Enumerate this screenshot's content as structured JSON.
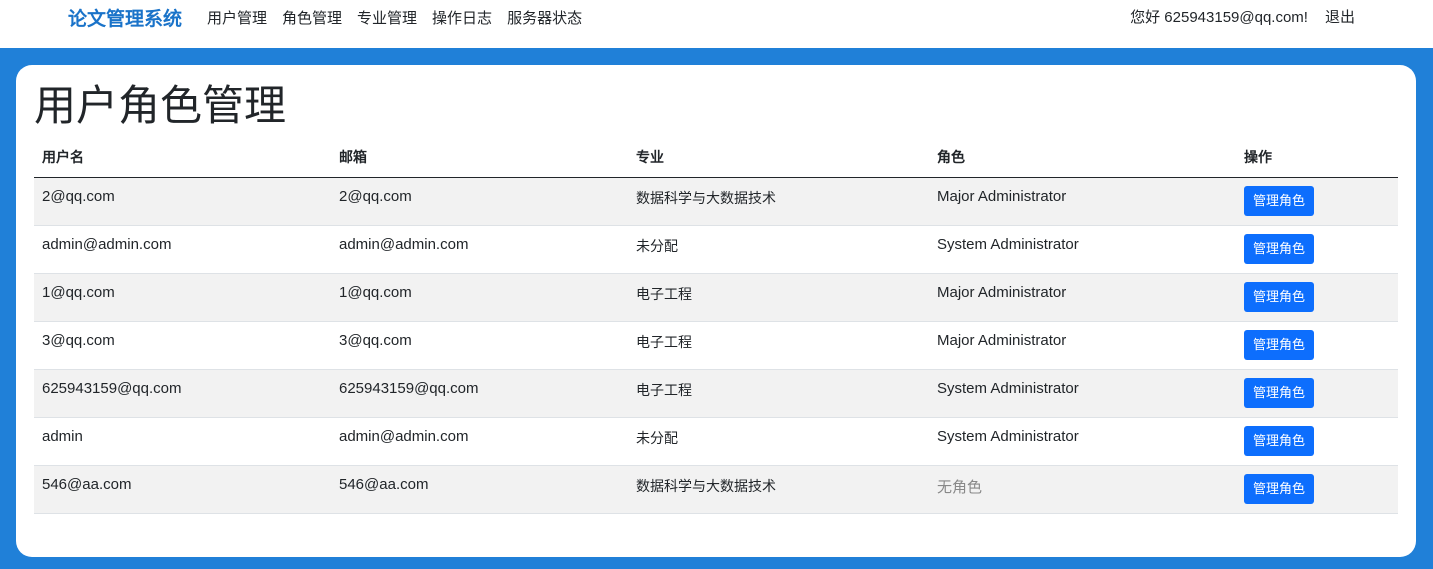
{
  "navbar": {
    "brand": "论文管理系统",
    "links": [
      "用户管理",
      "角色管理",
      "专业管理",
      "操作日志",
      "服务器状态"
    ],
    "greeting": "您好 625943159@qq.com!",
    "logout": "退出"
  },
  "page": {
    "title": "用户角色管理"
  },
  "table": {
    "headers": [
      "用户名",
      "邮箱",
      "专业",
      "角色",
      "操作"
    ],
    "rows": [
      {
        "username": "2@qq.com",
        "email": "2@qq.com",
        "major": "数据科学与大数据技术",
        "role": "Major Administrator",
        "action": "管理角色"
      },
      {
        "username": "admin@admin.com",
        "email": "admin@admin.com",
        "major": "未分配",
        "role": "System Administrator",
        "action": "管理角色"
      },
      {
        "username": "1@qq.com",
        "email": "1@qq.com",
        "major": "电子工程",
        "role": "Major Administrator",
        "action": "管理角色"
      },
      {
        "username": "3@qq.com",
        "email": "3@qq.com",
        "major": "电子工程",
        "role": "Major Administrator",
        "action": "管理角色"
      },
      {
        "username": "625943159@qq.com",
        "email": "625943159@qq.com",
        "major": "电子工程",
        "role": "System Administrator",
        "action": "管理角色"
      },
      {
        "username": "admin",
        "email": "admin@admin.com",
        "major": "未分配",
        "role": "System Administrator",
        "action": "管理角色"
      },
      {
        "username": "546@aa.com",
        "email": "546@aa.com",
        "major": "数据科学与大数据技术",
        "role": "无角色",
        "action": "管理角色"
      }
    ]
  },
  "colors": {
    "brand": "#1a73c9",
    "background": "#2080d8",
    "button": "#0d6efd",
    "no_role": "#888888"
  }
}
